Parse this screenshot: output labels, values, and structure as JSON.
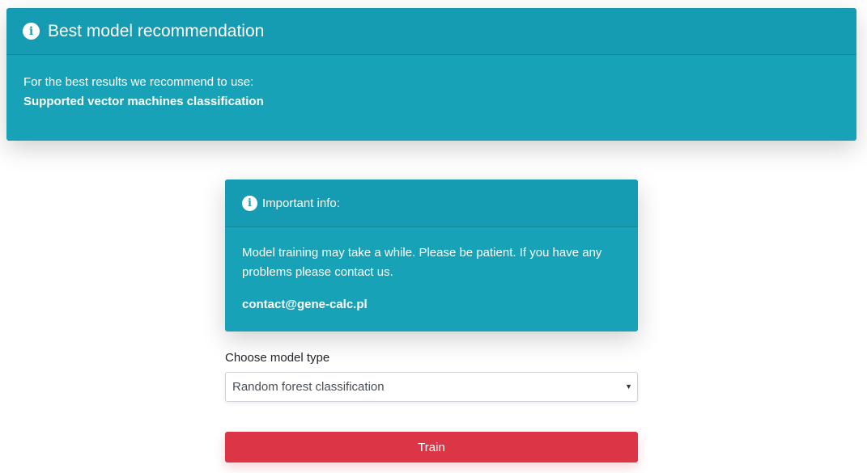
{
  "recommendation": {
    "title": "Best model recommendation",
    "intro": "For the best results we recommend to use:",
    "model": "Supported vector machines classification",
    "icon": "info-circle-icon"
  },
  "info": {
    "title": "Important info:",
    "message": "Model training may take a while. Please be patient. If you have any problems please contact us.",
    "email": "contact@gene-calc.pl",
    "icon": "info-circle-icon"
  },
  "form": {
    "label": "Choose model type",
    "selected": "Random forest classification",
    "train_label": "Train"
  },
  "colors": {
    "card_bg": "#17a2b8",
    "button_bg": "#dc3545"
  }
}
